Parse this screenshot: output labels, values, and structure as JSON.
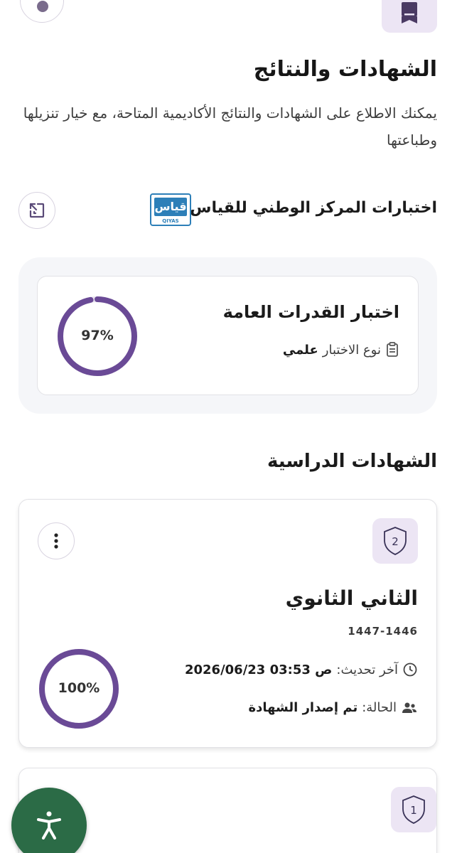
{
  "header": {
    "title": "الشهادات والنتائج",
    "description": "يمكنك الاطلاع على الشهادات والنتائج الأكاديمية المتاحة، مع خيار تنزيلها وطباعتها"
  },
  "qiyas": {
    "section_title": "اختبارات المركز الوطني للقياس",
    "logo_text": "قياس",
    "logo_caption": "QIYAS",
    "tests": [
      {
        "name": "اختبار القدرات العامة",
        "type_label": "نوع الاختبار",
        "type_value": "علمي",
        "percent_text": "97%",
        "percent": 97
      }
    ]
  },
  "certificates": {
    "section_title": "الشهادات الدراسية",
    "items": [
      {
        "badge_number": "2",
        "name": "الثاني الثانوي",
        "year": "1447-1446",
        "updated_label": "آخر تحديث:",
        "updated_value": "2026/06/23 03:53 ص",
        "status_label": "الحالة:",
        "status_value": "تم إصدار الشهادة",
        "percent_text": "100%",
        "percent": 100
      },
      {
        "badge_number": "1"
      }
    ]
  },
  "colors": {
    "accent": "#6a4a96",
    "badge_bg": "#ece5f4",
    "panel_bg": "#f5f6f9",
    "accessibility_bg": "#2b6b46",
    "qiyas_blue": "#2d7fb8"
  },
  "icons": {
    "top_left": "add-icon",
    "top_right": "certificate-icon",
    "expand": "expand-icon",
    "test_type": "clipboard-icon",
    "updated": "clock-icon",
    "status": "users-icon",
    "menu": "kebab-menu-icon",
    "accessibility": "accessibility-icon"
  }
}
